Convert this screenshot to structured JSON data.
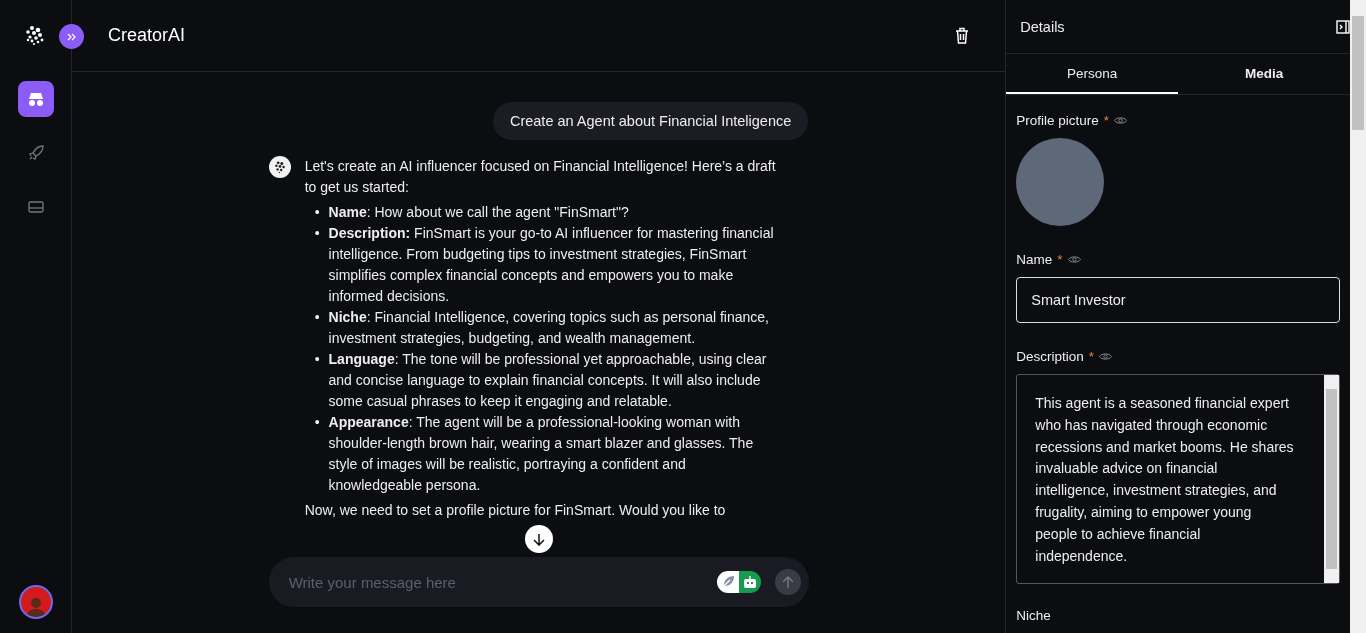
{
  "app": {
    "title": "CreatorAI"
  },
  "nav": [
    {
      "kind": "agent",
      "selected": true
    },
    {
      "kind": "rocket",
      "selected": false
    },
    {
      "kind": "panel",
      "selected": false
    }
  ],
  "chat": {
    "user_message": "Create an Agent about Financial Inteligence",
    "reply_intro": "Let's create an AI influencer focused on Financial Intelligence! Here’s a draft to get us started:",
    "reply_items": [
      {
        "bullet": "•",
        "label": "Name",
        "text": ": How about we call the agent \"FinSmart\"?"
      },
      {
        "bullet": "•",
        "label": "Description:",
        "text": " FinSmart is your go-to AI influencer for mastering financial intelligence. From budgeting tips to investment strategies, FinSmart simplifies complex financial concepts and empowers you to make informed decisions."
      },
      {
        "bullet": "•",
        "label": "Niche",
        "text": ": Financial Intelligence, covering topics such as personal finance, investment strategies, budgeting, and wealth management."
      },
      {
        "bullet": "•",
        "label": "Language",
        "text": ": The tone will be professional yet approachable, using clear and concise language to explain financial concepts. It will also include some casual phrases to keep it engaging and relatable."
      },
      {
        "bullet": "•",
        "label": "Appearance",
        "text": ": The agent will be a professional-looking woman with shoulder-length brown hair, wearing a smart blazer and glasses. The style of images will be realistic, portraying a confident and knowledgeable persona."
      }
    ],
    "reply_outro": "Now, we need to set a profile picture for FinSmart. Would you like to",
    "input": {
      "placeholder": "Write your message here"
    },
    "modes": [
      {
        "kind": "feather",
        "selected": false
      },
      {
        "kind": "robot",
        "selected": true
      }
    ]
  },
  "details": {
    "title": "Details",
    "tabs": [
      {
        "label": "Persona",
        "selected": true
      },
      {
        "label": "Media",
        "selected": false
      }
    ],
    "profile_label": "Profile picture",
    "required_mark": "*",
    "name_label": "Name",
    "name_value": "Smart Investor",
    "description_label": "Description",
    "description_value": "This agent is a seasoned financial expert who has navigated through economic recessions and market booms. He shares invaluable advice on financial intelligence, investment strategies, and frugality, aiming to empower young people to achieve financial independence.",
    "niche_label": "Niche"
  }
}
